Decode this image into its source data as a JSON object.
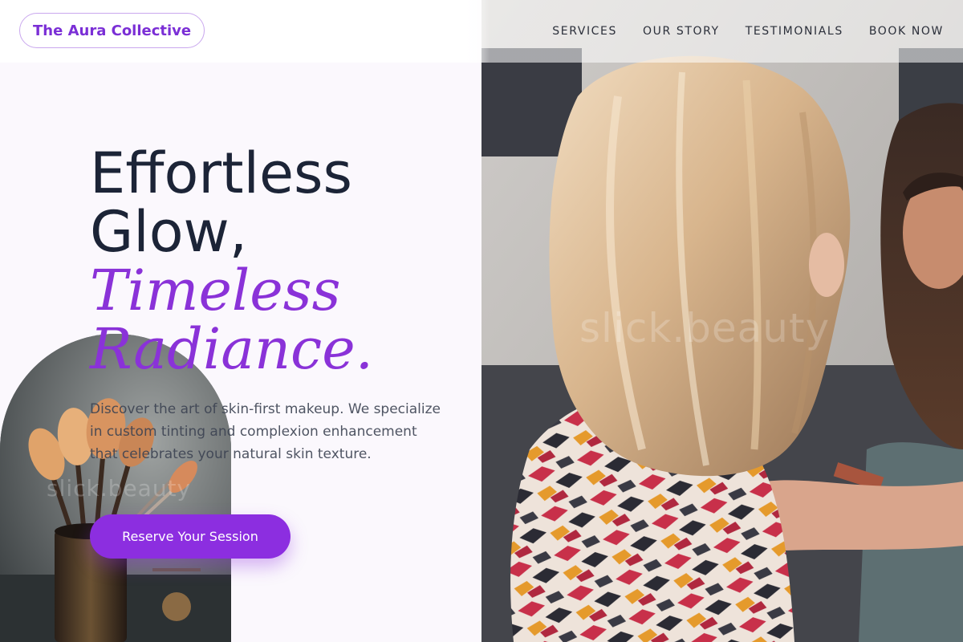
{
  "header": {
    "logo_text": "The Aura Collective",
    "nav": [
      {
        "label": "SERVICES"
      },
      {
        "label": "OUR STORY"
      },
      {
        "label": "TESTIMONIALS"
      },
      {
        "label": "BOOK NOW"
      }
    ]
  },
  "hero": {
    "headline_line1": "Effortless",
    "headline_line2": "Glow,",
    "headline_accent1": "Timeless",
    "headline_accent2": "Radiance.",
    "description": "Discover the art of skin-first makeup. We specialize in custom tinting and complexion enhancement that celebrates your natural skin texture.",
    "cta_label": "Reserve Your Session",
    "main_image_watermark": "slick.beauty",
    "arch_image_watermark": "slick.beauty"
  },
  "colors": {
    "accent": "#8c2ee0",
    "heading": "#1c2437",
    "background": "#fbf8fd"
  },
  "icons": {
    "hero_image": "makeup-artist-photo",
    "arch_image": "makeup-brushes-photo"
  }
}
